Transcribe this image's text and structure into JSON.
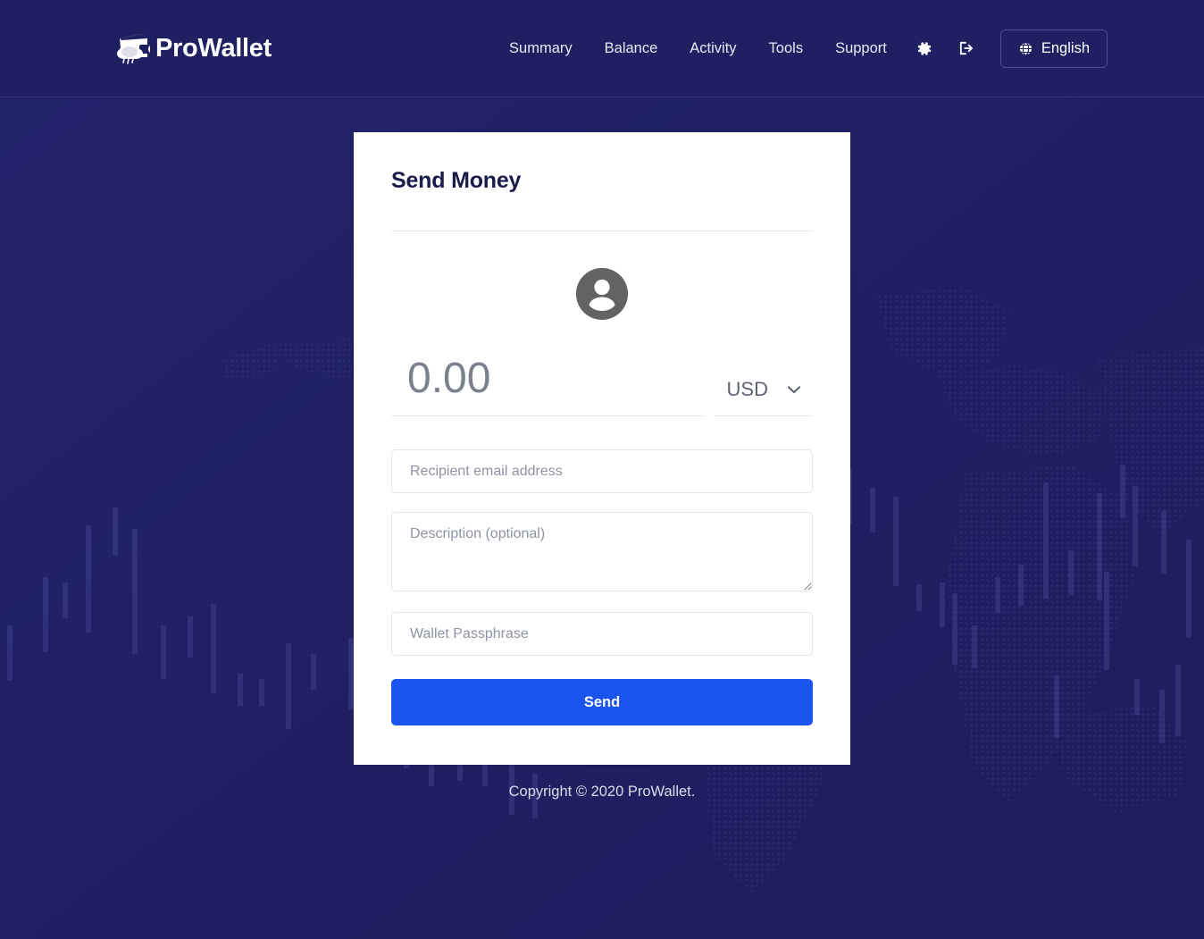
{
  "theme": {
    "background_navy": "#1f2062",
    "accent_blue": "#1c54ef",
    "card_white": "#ffffff",
    "nav_text": "#e8e9f5",
    "placeholder_gray": "#8d93a1",
    "avatar_gray": "#636363"
  },
  "header": {
    "brand": {
      "name": "ProWallet",
      "icon": "wallet-cloud-logo-icon"
    },
    "nav_items": [
      {
        "label": "Summary",
        "name": "nav-link-summary"
      },
      {
        "label": "Balance",
        "name": "nav-link-balance"
      },
      {
        "label": "Activity",
        "name": "nav-link-activity"
      },
      {
        "label": "Tools",
        "name": "nav-link-tools"
      },
      {
        "label": "Support",
        "name": "nav-link-support"
      }
    ],
    "settings_icon": "gear-icon",
    "logout_icon": "sign-out-icon",
    "language": {
      "label": "English",
      "icon": "globe-icon"
    }
  },
  "card": {
    "title": "Send Money",
    "avatar_icon": "user-avatar-icon",
    "amount": {
      "value": "",
      "placeholder": "0.00"
    },
    "currency": {
      "selected": "USD",
      "chevron_icon": "chevron-down-icon"
    },
    "recipient": {
      "value": "",
      "placeholder": "Recipient email address"
    },
    "description": {
      "value": "",
      "placeholder": "Description (optional)"
    },
    "passphrase": {
      "value": "",
      "placeholder": "Wallet Passphrase"
    },
    "submit_label": "Send"
  },
  "footer": {
    "copyright": "Copyright © 2020 ProWallet."
  }
}
